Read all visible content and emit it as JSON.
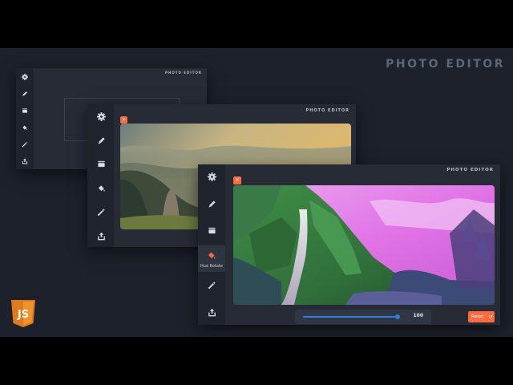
{
  "brand": {
    "title": "PHOTO EDITOR"
  },
  "windows": {
    "back": {
      "title": "PHOTO EDITOR"
    },
    "mid": {
      "title": "PHOTO EDITOR",
      "close": "✕"
    },
    "front": {
      "title": "PHOTO EDITOR",
      "close": "✕",
      "active_tool_label": "Hue Rotate",
      "slider_value": "100",
      "slider_level": 1.0,
      "reset_label": "Reset"
    }
  },
  "tools": [
    "settings-icon",
    "pencil-icon",
    "layers-icon",
    "paint-bucket-icon",
    "magic-wand-icon",
    "share-icon"
  ],
  "colors": {
    "accent": "#ff6a3d",
    "slider": "#2f7de1",
    "panel": "#262b35",
    "sidebar": "#1f232c",
    "stage": "#1c212b"
  },
  "badge": {
    "text": "JS",
    "color": "#f0932b"
  }
}
